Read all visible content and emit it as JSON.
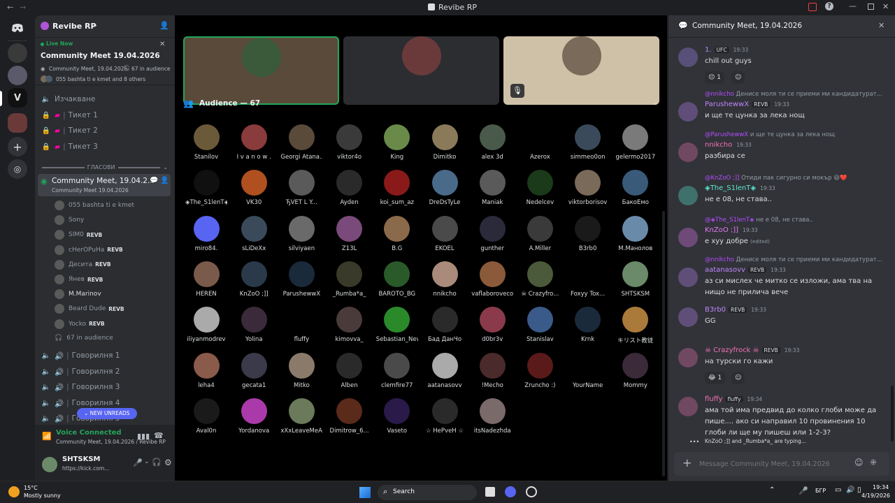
{
  "window": {
    "title": "Revibe RP"
  },
  "server": {
    "name": "Revibe RP"
  },
  "event": {
    "live_label": "Live Now",
    "title": "Community Meet 19.04.2026",
    "subtitle": "Community Meet, 19.04.2026",
    "audience_count": "67 in audience",
    "others": "055 bashta ti e kmet and 8 others"
  },
  "channels": {
    "waiting": "Изчакване",
    "ticket1": "Тикет 1",
    "ticket2": "Тикет 2",
    "ticket3": "Тикет 3",
    "voice_category": "ГЛАСОВИ",
    "stage_name": "Community Meet, 19.04.2...",
    "stage_sub": "Community Meet 19.04.2026",
    "talk1": "Говорилня 1",
    "talk2": "Говорилня 2",
    "talk3": "Говорилня 3",
    "talk4": "Говорилня 4",
    "talk5": "Говорилня 5",
    "new_unreads": "NEW UNREADS"
  },
  "stage_users": [
    {
      "name": "055 bashta ti e kmet",
      "tag": "",
      "color": "#949ba4"
    },
    {
      "name": "Sony",
      "tag": "",
      "color": "#949ba4"
    },
    {
      "name": "SIM0",
      "tag": "REVB",
      "color": "#949ba4"
    },
    {
      "name": "cHerOPuHa",
      "tag": "REVB",
      "color": "#949ba4"
    },
    {
      "name": "Десита",
      "tag": "REVB",
      "color": "#949ba4"
    },
    {
      "name": "Янев",
      "tag": "REVB",
      "color": "#949ba4"
    },
    {
      "name": "M.Marinov",
      "tag": "",
      "color": "#dbdee1"
    },
    {
      "name": "Beard Dude",
      "tag": "REVB",
      "color": "#949ba4"
    },
    {
      "name": "Yocko",
      "tag": "REVB",
      "color": "#949ba4"
    }
  ],
  "stage_audience": "67 in audience",
  "voice_panel": {
    "status": "Voice Connected",
    "channel": "Community Meet, 19.04.2026 / Revibe RP"
  },
  "user_panel": {
    "name": "SHTSKSM",
    "status": "https://kick.com..."
  },
  "audience": {
    "header": "Audience — 67",
    "members": [
      {
        "name": "Stanilov",
        "color": "#6b5a3a"
      },
      {
        "name": "I v a n o w .",
        "color": "#8a3b3b"
      },
      {
        "name": "Georgi Atana...",
        "color": "#5a4a3a"
      },
      {
        "name": "viktor4o",
        "color": "#3a3a3a"
      },
      {
        "name": "King",
        "color": "#6a8a4a"
      },
      {
        "name": "Dimitko",
        "color": "#8a7a5a"
      },
      {
        "name": "alex 3d",
        "color": "#4a5a4a"
      },
      {
        "name": "Azerox",
        "color": "#000000"
      },
      {
        "name": "simmeo0on",
        "color": "#3a4a5a"
      },
      {
        "name": "gelermo2017",
        "color": "#7a7a7a"
      },
      {
        "name": "◈The_S1lenT◈",
        "color": "#101010"
      },
      {
        "name": "VK30",
        "color": "#b05020"
      },
      {
        "name": "ЂVEТ L Y...",
        "color": "#5a5a5a"
      },
      {
        "name": "Ayden",
        "color": "#2a2a2a"
      },
      {
        "name": "koi_sum_az",
        "color": "#8a1a1a"
      },
      {
        "name": "DreDsTyLe",
        "color": "#4a6a8a"
      },
      {
        "name": "Maniak",
        "color": "#5a5a5a"
      },
      {
        "name": "Nedelcev",
        "color": "#1a3a1a"
      },
      {
        "name": "viktorborisov",
        "color": "#7a6a5a"
      },
      {
        "name": "БакоЕмо",
        "color": "#3a5a7a"
      },
      {
        "name": "miro84.",
        "color": "#5865f2"
      },
      {
        "name": "sLiDeXx",
        "color": "#3a4a5a"
      },
      {
        "name": "silviyaen",
        "color": "#6a6a6a"
      },
      {
        "name": "Z13L",
        "color": "#7a4a7a"
      },
      {
        "name": "B.G",
        "color": "#8a6a4a"
      },
      {
        "name": "EKOEL",
        "color": "#4a4a4a"
      },
      {
        "name": "gunther",
        "color": "#2a2a3a"
      },
      {
        "name": "A.Miller",
        "color": "#3a3a3a"
      },
      {
        "name": "B3rb0",
        "color": "#1a1a1a"
      },
      {
        "name": "M.Манолов",
        "color": "#6a8aaa"
      },
      {
        "name": "HEREN",
        "color": "#7a5a4a"
      },
      {
        "name": "KnZoO ;]]",
        "color": "#2a3a4a"
      },
      {
        "name": "ParushewwX",
        "color": "#1a2a3a"
      },
      {
        "name": "_Rumba*a_",
        "color": "#3a3a2a"
      },
      {
        "name": "BAROTO_BG",
        "color": "#2a5a2a"
      },
      {
        "name": "nnikcho",
        "color": "#aa8a7a"
      },
      {
        "name": "vaflaboroveco...",
        "color": "#8a5a3a"
      },
      {
        "name": "☠ Crazyfro...",
        "color": "#4a5a3a"
      },
      {
        "name": "Foxyy Tox...",
        "color": "#000000"
      },
      {
        "name": "SHTSKSM",
        "color": "#6a8a6a"
      },
      {
        "name": "iliyanmodrev",
        "color": "#aaaaaa"
      },
      {
        "name": "Yolina",
        "color": "#3a2a3a"
      },
      {
        "name": "fluffy",
        "color": "#000000"
      },
      {
        "name": "kimovva_",
        "color": "#4a3a3a"
      },
      {
        "name": "Sebastian_New",
        "color": "#2a8a2a"
      },
      {
        "name": "Бад ДанЧо",
        "color": "#2a2a2a"
      },
      {
        "name": "d0br3v",
        "color": "#8a3a4a"
      },
      {
        "name": "Stanislav",
        "color": "#3a5a8a"
      },
      {
        "name": "Krnk",
        "color": "#1a2a3a"
      },
      {
        "name": "キリスト教徒",
        "color": "#aa7a3a"
      },
      {
        "name": "leha4",
        "color": "#8a5a4a"
      },
      {
        "name": "gecata1",
        "color": "#3a3a4a"
      },
      {
        "name": "Mitko",
        "color": "#8a7a6a"
      },
      {
        "name": "Alben",
        "color": "#2a2a2a"
      },
      {
        "name": "clemfire77",
        "color": "#4a4a4a"
      },
      {
        "name": "aatanasovv",
        "color": "#aaaaaa"
      },
      {
        "name": "!Mecho",
        "color": "#4a2a2a"
      },
      {
        "name": "Zruncho :)",
        "color": "#5a1a1a"
      },
      {
        "name": "YourName",
        "color": "#000000"
      },
      {
        "name": "Mommy",
        "color": "#3a2a3a"
      },
      {
        "name": "Aval0n",
        "color": "#1a1a1a"
      },
      {
        "name": "Yordanova",
        "color": "#aa3aaa"
      },
      {
        "name": "xXxLeaveMeA...",
        "color": "#6a7a5a"
      },
      {
        "name": "Dimitrow_6...",
        "color": "#5a2a1a"
      },
      {
        "name": "Vaseto",
        "color": "#2a1a4a"
      },
      {
        "name": "☆ HePveH ☆",
        "color": "#2a2a2a"
      },
      {
        "name": "itsNadezhda",
        "color": "#7a6a6a"
      }
    ]
  },
  "chat": {
    "header": "Community Meet, 19.04.2026",
    "placeholder": "Message Community Meet, 19.04.2026",
    "typing": "KnZoO ;]] and _Rumba*a_ are typing...",
    "messages": [
      {
        "author": "1.",
        "tag": "UFC",
        "time": "19:33",
        "color": "#a78bfa",
        "text": "chill out guys",
        "reply_to": "",
        "reply_text": "",
        "reaction": "😔",
        "reaction_count": "1"
      },
      {
        "author": "ParushewwX",
        "tag": "REVB",
        "time": "19:33",
        "color": "#c084fc",
        "text": "и ще те цунка за лека нощ",
        "reply_to": "@nnikcho",
        "reply_text": "Денисе моля ти се приеми ми кандидатурат...",
        "reaction": "",
        "reaction_count": ""
      },
      {
        "author": "nnikcho",
        "tag": "",
        "time": "19:33",
        "color": "#f472b6",
        "text": "разбира се",
        "reply_to": "@ParushewwX",
        "reply_text": "и ще те цунка за лека нощ",
        "reaction": "",
        "reaction_count": ""
      },
      {
        "author": "◈The_S1lenT◈",
        "tag": "",
        "time": "19:33",
        "color": "#5eead4",
        "text": "не е 08, не става..",
        "reply_to": "@KnZoO ;]]",
        "reply_text": "Отиди пак сигурно си мокър 😆❤️",
        "reaction": "",
        "reaction_count": ""
      },
      {
        "author": "KnZoO ;]]",
        "tag": "",
        "time": "19:33",
        "color": "#e879f9",
        "text": "е xyy добре",
        "edited": "(edited)",
        "reply_to": "@◈The_S1lenT◈",
        "reply_text": "не е 08, не става..",
        "reaction": "",
        "reaction_count": ""
      },
      {
        "author": "aatanasovv",
        "tag": "REVB",
        "time": "19:33",
        "color": "#c084fc",
        "text": "аз си мислех че митко се изложи, ама тва на нищо не прилича вече",
        "reply_to": "@nnikcho",
        "reply_text": "Денисе моля ти се приеми ми кандидатурат...",
        "reaction": "",
        "reaction_count": ""
      },
      {
        "author": "B3rb0",
        "tag": "REVB",
        "time": "19:33",
        "color": "#c084fc",
        "text": "GG",
        "reply_to": "",
        "reply_text": "",
        "reaction": "",
        "reaction_count": ""
      },
      {
        "author": "☠ Crazyfrock ☠",
        "tag": "REVB",
        "time": "19:33",
        "color": "#f472b6",
        "text": "на турски го кажи",
        "reply_to": "",
        "reply_text": "",
        "reaction": "😂",
        "reaction_count": "1"
      },
      {
        "author": "fluffy",
        "tag": "fluffy",
        "time": "19:34",
        "color": "#f472b6",
        "text": "ама той има предвид до колко глоби може да пише.... ако си направил 10 провинения 10 глоби ли ще му пишеш или 1-2-3?",
        "reply_to": "",
        "reply_text": "",
        "reaction": "",
        "reaction_count": ""
      }
    ]
  },
  "taskbar": {
    "temp": "15°C",
    "weather": "Mostly sunny",
    "search": "Search",
    "lang": "БГР",
    "time": "19:34",
    "date": "4/19/2026"
  }
}
